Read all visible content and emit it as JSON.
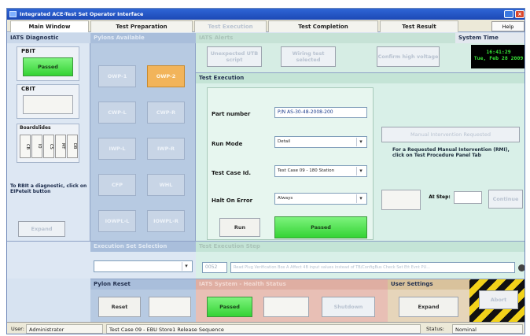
{
  "window": {
    "title": "Integrated ACE-Test Set Operator Interface"
  },
  "tabs": [
    {
      "label": "Main Window",
      "active": true
    },
    {
      "label": "Test Preparation",
      "active": false
    },
    {
      "label": "Test Execution",
      "active": false
    },
    {
      "label": "Test Completion",
      "active": false
    },
    {
      "label": "Test Result",
      "active": false
    }
  ],
  "help_label": "Help",
  "iats": {
    "title": "IATS Diagnostic",
    "pbit_label": "PBIT",
    "pbit_status": "Passed",
    "cbit_label": "CBIT",
    "group_label": "Boardslides",
    "mini_items": [
      "CB",
      "IO",
      "CS",
      "MT",
      "DB"
    ],
    "info_text": "To RBIt a diagnostic, click on EIPeteit button",
    "expand_label": "Expand"
  },
  "pylons": {
    "title": "Pylons Available",
    "buttons": [
      "OWP-1",
      "OWP-2",
      "CWP-L",
      "CWP-R",
      "IWP-L",
      "IWP-R",
      "CFP",
      "WHL",
      "IOWPL-L",
      "IOWPL-R"
    ]
  },
  "execution_set": {
    "title": "Execution Set Selection"
  },
  "pylon_reset": {
    "title": "Pylon Reset",
    "reset_label": "Reset"
  },
  "iats_alerts": {
    "title": "IATS Alerts",
    "buttons": [
      "Unexpected UTB script",
      "Wiring test selected",
      "Confirm high voltage"
    ]
  },
  "system_time": {
    "title": "System Time",
    "time": "16:41:29",
    "date": "Tue, Feb 28 2009"
  },
  "test_execution": {
    "title": "Test Execution",
    "part_number_label": "Part number",
    "part_number_value": "P/N AS-30-48-2008-200",
    "run_mode_label": "Run Mode",
    "run_mode_value": "Detail",
    "test_case_label": "Test Case Id.",
    "test_case_value": "Test Case 09 - 180 Station",
    "halt_label": "Halt On Error",
    "halt_value": "Always",
    "run_label": "Run",
    "passed_label": "Passed",
    "manual_button_label": "Manual Intervention Requested",
    "manual_info": "For a Requested Manual Intervention (RMI), click on Test Procedure Panel Tab",
    "at_step_label": "At Step:",
    "continue_label": "Continue"
  },
  "execution_step": {
    "title": "Test Execution Step",
    "step_id": "0052",
    "step_text": "Read Plug Verification Box A Affect 4B input values instead of TB/ConfigBus Check Set Ett Evnt PU..."
  },
  "health": {
    "title": "IATS System - Health Status",
    "status_label": "Passed",
    "shutdown_label": "Shutdown"
  },
  "user_settings": {
    "title": "User Settings",
    "expand_label": "Expand"
  },
  "abort_label": "Abort",
  "status_bar": {
    "user_label": "User:",
    "user_value": "Administrator",
    "message": "Test Case 09 - EBU Store1 Release Sequence",
    "status_label": "Status:",
    "status_value": "Nominal"
  },
  "colors": {
    "accent_green": "#34d334",
    "alert_orange": "#f2b45a",
    "title_blue": "#1c48b5",
    "panel_blue": "#b7cae2",
    "panel_mint": "#d9f0e8",
    "panel_rose": "#e8bfb5"
  }
}
